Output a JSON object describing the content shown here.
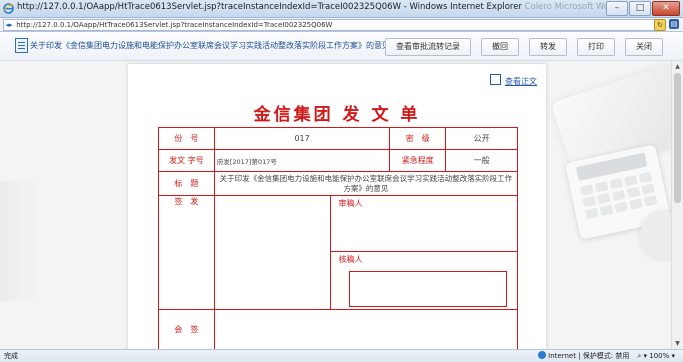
{
  "window": {
    "title": "http://127.0.0.1/OAapp/HtTrace0613Servlet.jsp?traceInstanceIndexId=TraceI002325Q06W - Windows Internet Explorer",
    "title_ghost": "Colero  Microsoft Word",
    "minimize": "–",
    "maximize": "□",
    "close": "✕"
  },
  "addressbar": {
    "url": "http://127.0.0.1/OAapp/HtTrace0613Servlet.jsp?traceInstanceIndexId=TraceI002325Q06W"
  },
  "toolbar": {
    "doc_title": "关于印发《金信集团电力设施和电能保护办公室联席会议学习实践活动整改落实阶段工作方案》的意见",
    "buttons": [
      "查看审批流转记录",
      "撤回",
      "转发",
      "打印",
      "关闭"
    ]
  },
  "document": {
    "view_link": "查看正文",
    "form_title": "金信集团 发 文 单",
    "rows": {
      "fenhao_label": "份　号",
      "fenhao_value": "017",
      "miji_label": "密　级",
      "miji_value": "公开",
      "fawen_label": "发文 字号",
      "fawen_value": "府发[2017]第017号",
      "jinji_label": "紧急程度",
      "jinji_value": "一般",
      "biaoti_label": "标　题",
      "biaoti_value": "关于印发《金信集团电力设施和电能保护办公室联席会议学习实践活动整改落实阶段工作方案》的意见",
      "qianfa_label": "签　发",
      "shengao_label": "审稿人",
      "hegao_label": "核稿人",
      "bottom_label": "会　签"
    }
  },
  "statusbar": {
    "left": "完成",
    "zone": "Internet | 保护模式: 禁用",
    "zoom": "100%"
  },
  "colors": {
    "form_red": "#d01818",
    "link_blue": "#2458a6"
  }
}
